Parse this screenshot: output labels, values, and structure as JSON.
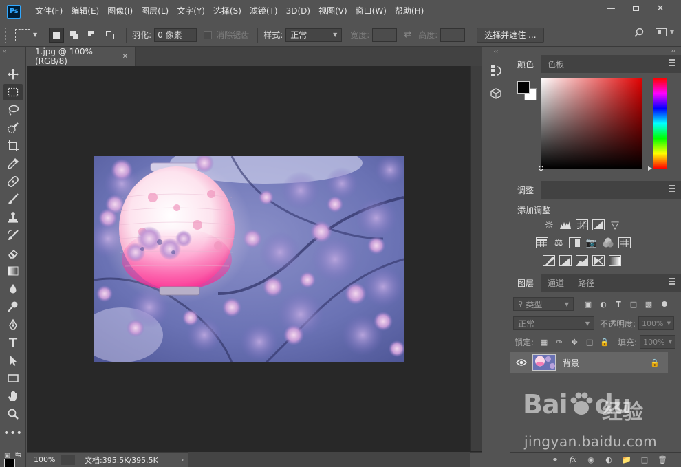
{
  "app": {
    "logo": "Ps",
    "menus": [
      "文件(F)",
      "编辑(E)",
      "图像(I)",
      "图层(L)",
      "文字(Y)",
      "选择(S)",
      "滤镜(T)",
      "3D(D)",
      "视图(V)",
      "窗口(W)",
      "帮助(H)"
    ]
  },
  "options": {
    "feather_label": "羽化:",
    "feather_value": "0 像素",
    "antialias_label": "消除锯齿",
    "style_label": "样式:",
    "style_value": "正常",
    "width_label": "宽度:",
    "height_label": "高度:",
    "select_mask_button": "选择并遮住 ..."
  },
  "document": {
    "tab_title": "1.jpg @ 100%(RGB/8)",
    "zoom": "100%",
    "doc_info": "文档:395.5K/395.5K"
  },
  "panels": {
    "color_tabs": [
      "颜色",
      "色板"
    ],
    "adjust_tab": "调整",
    "adjust_title": "添加调整",
    "layer_tabs": [
      "图层",
      "通道",
      "路径"
    ],
    "filter_placeholder": "类型",
    "blend_mode": "正常",
    "opacity_label": "不透明度:",
    "opacity_value": "100%",
    "lock_label": "锁定:",
    "fill_label": "填充:",
    "fill_value": "100%",
    "layer_name": "背景"
  },
  "watermark": {
    "logo_left": "Bai",
    "logo_right": "du",
    "cn": "经验",
    "url": "jingyan.baidu.com"
  }
}
